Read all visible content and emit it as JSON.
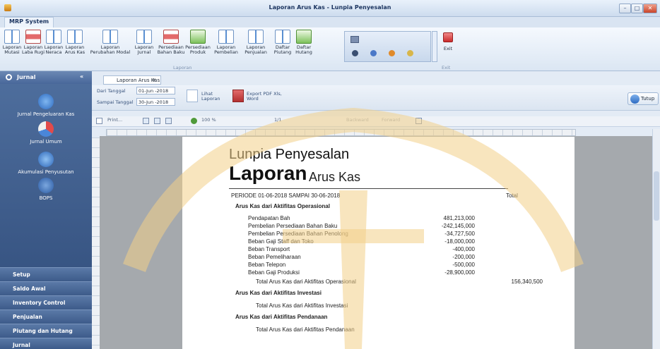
{
  "window": {
    "title": "Laporan Arus Kas - Lunpia Penyesalan",
    "min": "–",
    "max": "□",
    "close": "✕"
  },
  "ribbon": {
    "tab": "MRP System",
    "buttons": [
      {
        "label": "Laporan Mutasi",
        "icon": "report-x-icon"
      },
      {
        "label": "Laporan Laba Rugi",
        "icon": "report-red-icon"
      },
      {
        "label": "Laporan Neraca",
        "icon": "report-x-icon"
      },
      {
        "label": "Laporan Arus Kas",
        "icon": "report-bracket-icon"
      },
      {
        "label": "Laporan Perubahan Modal",
        "icon": "report-percent-icon"
      },
      {
        "label": "Laporan Jurnal",
        "icon": "report-10-icon"
      },
      {
        "label": "Persediaan Bahan Baku",
        "icon": "heart-inventory-icon"
      },
      {
        "label": "Persediaan Produk",
        "icon": "product-grid-icon"
      },
      {
        "label": "Laporan Pembelian",
        "icon": "purchase-icon"
      },
      {
        "label": "Laporan Penjualan",
        "icon": "sales-icon"
      },
      {
        "label": "Daftar Piutang",
        "icon": "receivable-icon"
      },
      {
        "label": "Daftar Hutang",
        "icon": "payable-icon"
      }
    ],
    "group_laporan": "Laporan",
    "exit_label": "Exit",
    "group_exit": "Exit"
  },
  "sidebar": {
    "header": "Jurnal",
    "collapse": "«",
    "items": [
      {
        "label": "Jurnal Pengeluaran Kas"
      },
      {
        "label": "Jurnal Umum"
      },
      {
        "label": "Akumulasi Penyusutan"
      },
      {
        "label": "BOPS"
      }
    ],
    "nav": [
      "Setup",
      "Saldo Awal",
      "Inventory Control",
      "Penjualan",
      "Piutang dan Hutang",
      "Jurnal"
    ]
  },
  "doc_tab": {
    "label": "Laporan Arus Kas",
    "close": "✕"
  },
  "filter": {
    "from_label": "Dari Tanggal",
    "from_value": "01-Jun -2018",
    "to_label": "Sampai Tanggal",
    "to_value": "30-Jun -2018",
    "view_label": "Lihat Laporan",
    "export_label": "Export PDF Xls, Word",
    "close_label": "Tutup"
  },
  "preview_toolbar": {
    "print": "Print...",
    "zoom": "100 %",
    "page": "1/1",
    "backward": "Backward",
    "forward": "Forward"
  },
  "report": {
    "company": "Lunpia Penyesalan",
    "title_big": "Laporan",
    "title_small": "Arus Kas",
    "period": "PERIODE 01-06-2018 SAMPAI 30-06-2018",
    "total_header": "Total",
    "sec1": "Arus Kas dari Aktifitas Operasional",
    "rows": [
      {
        "label": "Pendapatan Bah",
        "value": "481,213,000"
      },
      {
        "label": "Pembelian Persediaan Bahan Baku",
        "value": "-242,145,000"
      },
      {
        "label": "Pembelian Persediaan Bahan Penolong",
        "value": "-34,727,500"
      },
      {
        "label": "Beban Gaji Staff dan Toko",
        "value": "-18,000,000"
      },
      {
        "label": "Beban Transport",
        "value": "-400,000"
      },
      {
        "label": "Beban Pemeliharaan",
        "value": "-200,000"
      },
      {
        "label": "Beban Telepon",
        "value": "-500,000"
      },
      {
        "label": "Beban Gaji Produksi",
        "value": "-28,900,000"
      }
    ],
    "total1_label": "Total Arus Kas dari Aktifitas Operasional",
    "total1_value": "156,340,500",
    "sec2": "Arus Kas dari Aktifitas Investasi",
    "total2_label": "Total Arus Kas dari Aktifitas Investasi",
    "sec3": "Arus Kas dari Aktifitas Pendanaan",
    "total3_label": "Total Arus Kas dari Aktifitas Pendanaan"
  }
}
